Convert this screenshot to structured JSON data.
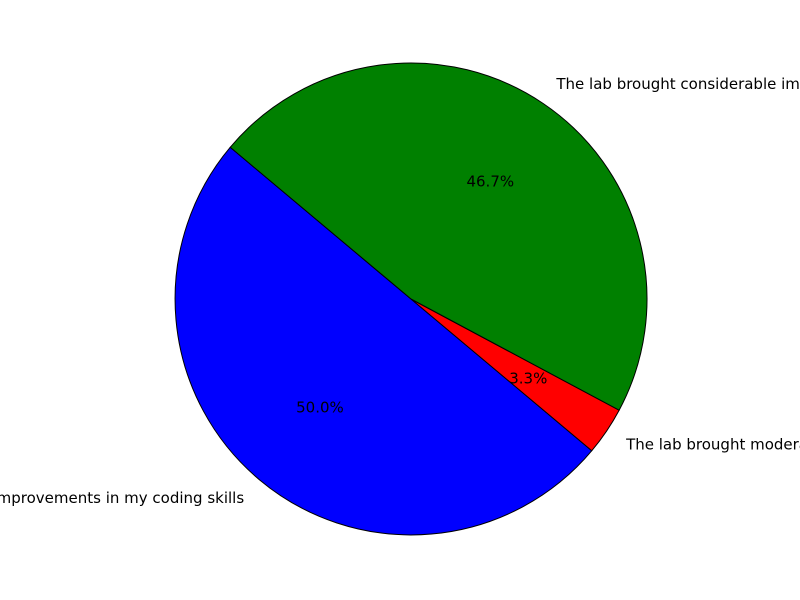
{
  "chart_data": {
    "type": "pie",
    "title": "",
    "start_angle_deg": 140,
    "direction": "counterclockwise",
    "slices": [
      {
        "label": "The lab brought considerable improvements in my coding skills",
        "value": 50.0,
        "pct_label": "50.0%",
        "color": "#0000ff"
      },
      {
        "label": "The lab brought moderate improvements to my coding skills",
        "value": 3.3,
        "pct_label": "3.3%",
        "color": "#ff0000"
      },
      {
        "label": "The lab brought considerable improvements in my coding skills",
        "value": 46.7,
        "pct_label": "46.7%",
        "color": "#008000"
      }
    ]
  }
}
